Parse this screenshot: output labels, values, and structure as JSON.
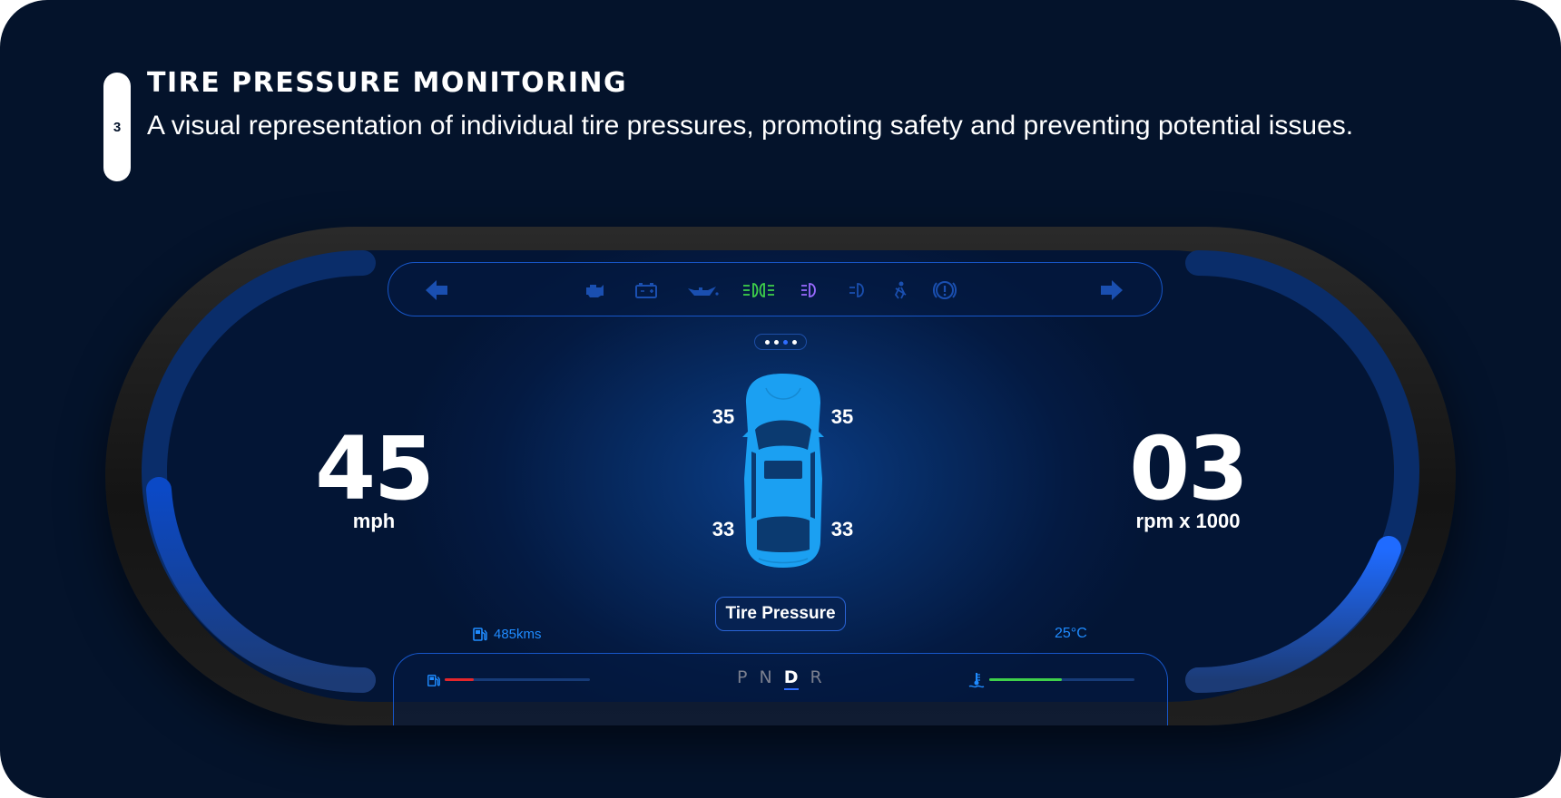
{
  "step": {
    "number": "3"
  },
  "header": {
    "title": "TIRE PRESSURE MONITORING",
    "description": "A visual representation of individual tire pressures, promoting safety and preventing potential issues."
  },
  "colors": {
    "background": "#04132b",
    "accent_blue": "#2f6dff",
    "car_body": "#1ba0f2",
    "headlight_green": "#3fd14a",
    "highbeam_purple": "#9a6bff",
    "fuel_red": "#e5262b",
    "coolant_green": "#3fd14a"
  },
  "indicators": {
    "left_turn": "left-turn-arrow-icon",
    "right_turn": "right-turn-arrow-icon",
    "warnings": [
      "engine-icon",
      "battery-icon",
      "oil-can-icon",
      "headlights-icon",
      "high-beam-icon",
      "fog-light-icon",
      "seatbelt-icon",
      "brake-warning-icon"
    ]
  },
  "pager": {
    "count": 4,
    "active_index": 2
  },
  "speed": {
    "value": "45",
    "unit": "mph",
    "gauge_level": 0.3
  },
  "rpm": {
    "value": "03",
    "unit": "rpm x 1000",
    "gauge_level": 0.3
  },
  "tires": {
    "front_left": "35",
    "front_right": "35",
    "rear_left": "33",
    "rear_right": "33"
  },
  "mode_button": {
    "label": "Tire Pressure"
  },
  "range": {
    "value": "485kms"
  },
  "temperature": {
    "value": "25°C"
  },
  "fuel_gauge": {
    "level": 0.2
  },
  "coolant_gauge": {
    "level": 0.5
  },
  "gears": {
    "items": [
      "P",
      "N",
      "D",
      "R"
    ],
    "active": "D"
  }
}
